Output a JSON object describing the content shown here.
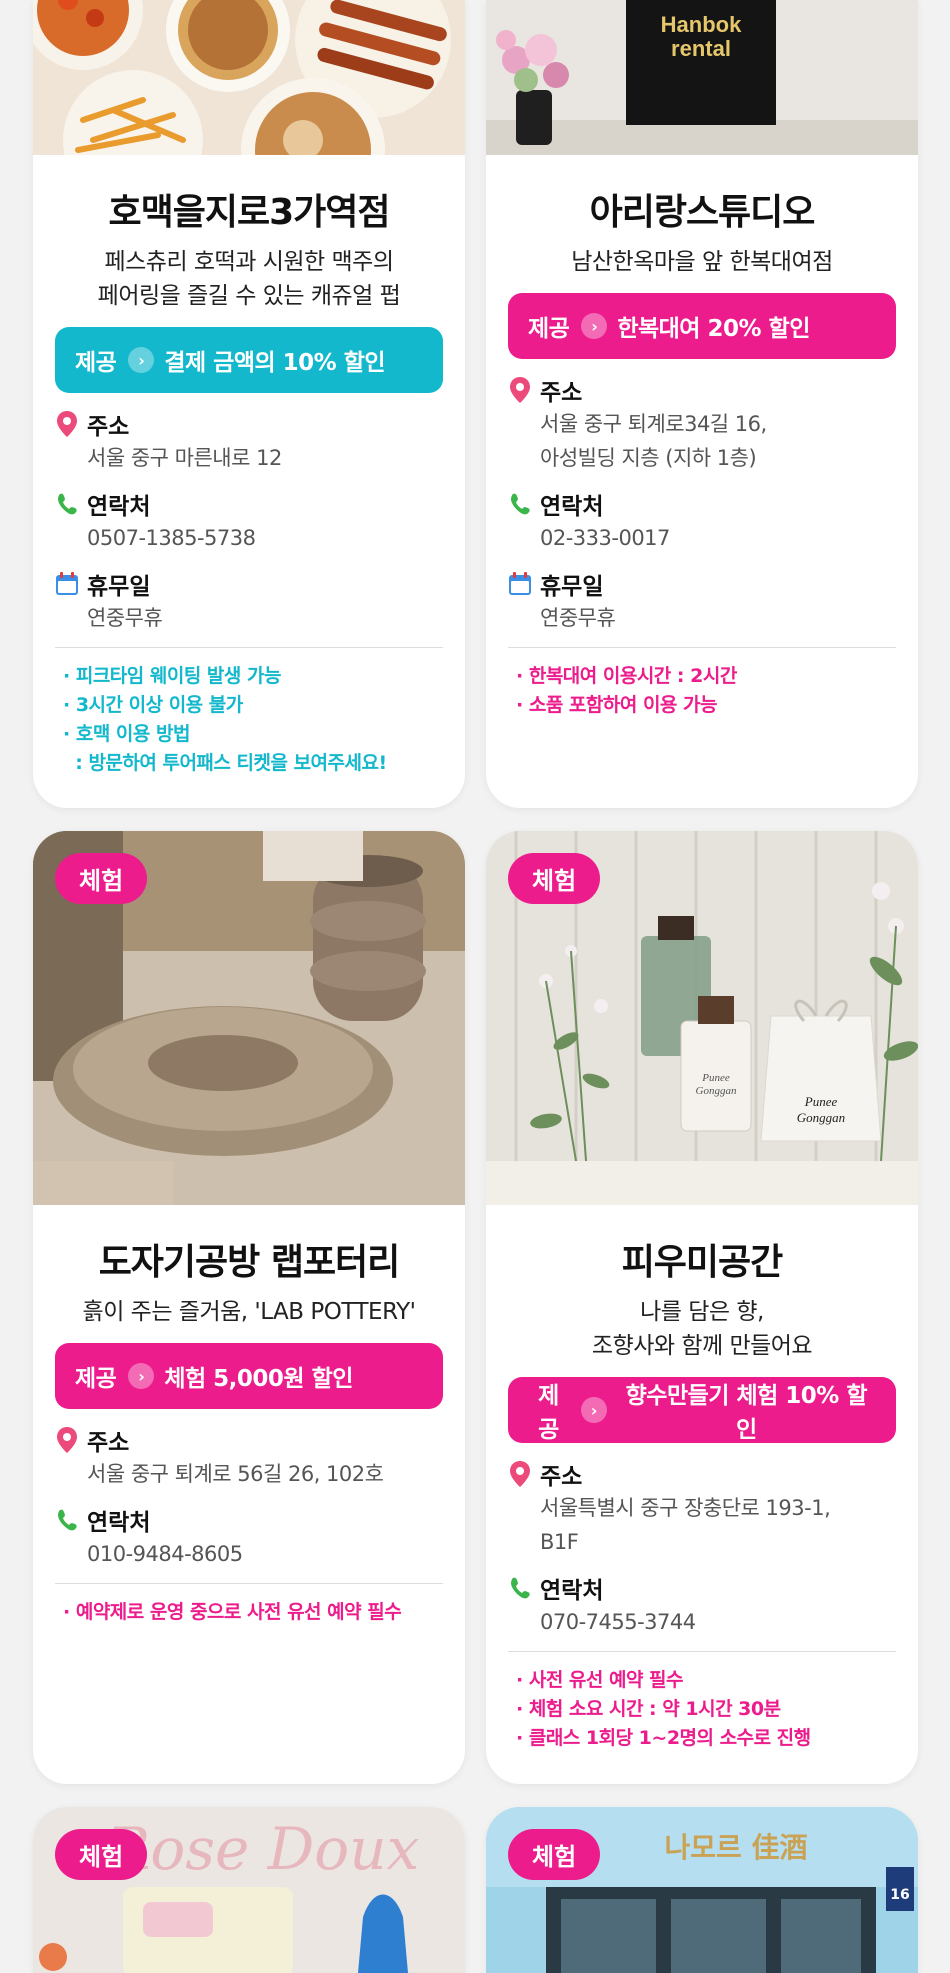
{
  "colors": {
    "pink": "#ec1c8c",
    "cyan": "#13b8cc"
  },
  "cards": [
    {
      "title": "호맥을지로3가역점",
      "subtitle": "페스츄리 호떡과 시원한 맥주의",
      "subtitle2": "페어링을 즐길 수 있는 캐쥬얼 펍",
      "offer_label": "제공",
      "offer_text": "결제 금액의 10% 할인",
      "address_label": "주소",
      "address": "서울 중구 마른내로 12",
      "contact_label": "연락처",
      "contact": "0507-1385-5738",
      "closed_label": "휴무일",
      "closed": "연중무휴",
      "notes": [
        "· 피크타임 웨이팅 발생 가능",
        "· 3시간 이상 이용 불가",
        "· 호맥 이용 방법",
        "  : 방문하여 투어패스 티켓을 보여주세요!"
      ]
    },
    {
      "photo_text1": "Hanbok",
      "photo_text2": "rental",
      "title": "아리랑스튜디오",
      "subtitle": "남산한옥마을 앞 한복대여점",
      "offer_label": "제공",
      "offer_text": "한복대여 20% 할인",
      "address_label": "주소",
      "address": "서울 중구 퇴계로34길 16,",
      "address2": "아성빌딩 지층 (지하 1층)",
      "contact_label": "연락처",
      "contact": "02-333-0017",
      "closed_label": "휴무일",
      "closed": "연중무휴",
      "notes": [
        "· 한복대여 이용시간 : 2시간",
        "· 소품 포함하여 이용 가능"
      ]
    },
    {
      "badge": "체험",
      "title": "도자기공방 랩포터리",
      "subtitle": "흙이 주는 즐거움, 'LAB POTTERY'",
      "offer_label": "제공",
      "offer_text": "체험 5,000원 할인",
      "address_label": "주소",
      "address": "서울 중구 퇴계로 56길 26, 102호",
      "contact_label": "연락처",
      "contact": "010-9484-8605",
      "notes": [
        "· 예약제로 운영 중으로 사전 유선 예약 필수"
      ]
    },
    {
      "badge": "체험",
      "photo_text1": "Punee",
      "photo_text2": "Gonggan",
      "title": "피우미공간",
      "subtitle": "나를 담은 향,",
      "subtitle2": "조향사와 함께 만들어요",
      "offer_label": "제공",
      "offer_text": "향수만들기 체험 10% 할인",
      "address_label": "주소",
      "address": "서울특별시 중구 장충단로 193-1,",
      "address2": "B1F",
      "contact_label": "연락처",
      "contact": "070-7455-3744",
      "notes": [
        "· 사전 유선 예약 필수",
        "· 체험 소요 시간 : 약 1시간 30분",
        "· 클래스 1회당 1~2명의 소수로 진행"
      ]
    },
    {
      "badge": "체험",
      "photo_text1": "Rose Doux"
    },
    {
      "badge": "체험",
      "photo_text1": "나모르 佳酒",
      "photo_text2": "16"
    }
  ]
}
